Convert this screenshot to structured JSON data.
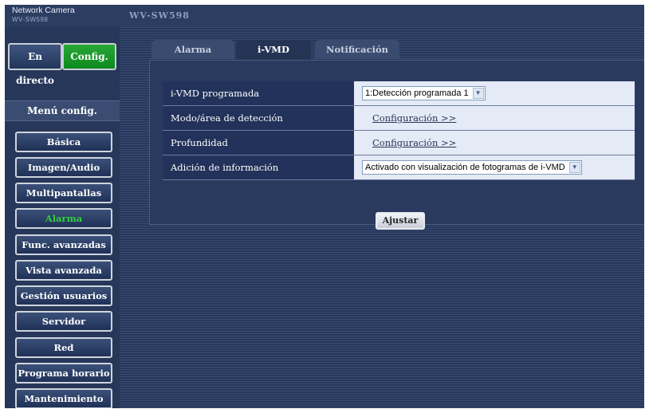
{
  "header": {
    "brand_title": "Network Camera",
    "brand_subtitle": "WV-SW598",
    "model": "WV-SW598"
  },
  "mode": {
    "live_label": "En directo",
    "config_label": "Config."
  },
  "sidebar": {
    "heading": "Menú config.",
    "items": [
      {
        "label": "Básica"
      },
      {
        "label": "Imagen/Audio"
      },
      {
        "label": "Multipantallas"
      },
      {
        "label": "Alarma"
      },
      {
        "label": "Func. avanzadas"
      },
      {
        "label": "Vista avanzada"
      },
      {
        "label": "Gestión usuarios"
      },
      {
        "label": "Servidor"
      },
      {
        "label": "Red"
      },
      {
        "label": "Programa horario"
      },
      {
        "label": "Mantenimiento"
      }
    ],
    "active_item": "Alarma"
  },
  "tabs": [
    {
      "label": "Alarma"
    },
    {
      "label": "i-VMD"
    },
    {
      "label": "Notificación"
    }
  ],
  "settings": {
    "rows": [
      {
        "label": "i-VMD programada",
        "value": "1:Detección programada 1"
      },
      {
        "label": "Modo/área de detección",
        "value": "Configuración >>"
      },
      {
        "label": "Profundidad",
        "value": "Configuración >>"
      },
      {
        "label": "Adición de información",
        "value": "Activado con visualización de fotogramas de i-VMD"
      }
    ],
    "apply_label": "Ajustar"
  },
  "colors": {
    "accent_green": "#1fa32e",
    "active_text": "#2fd23e",
    "background": "#27375a"
  }
}
